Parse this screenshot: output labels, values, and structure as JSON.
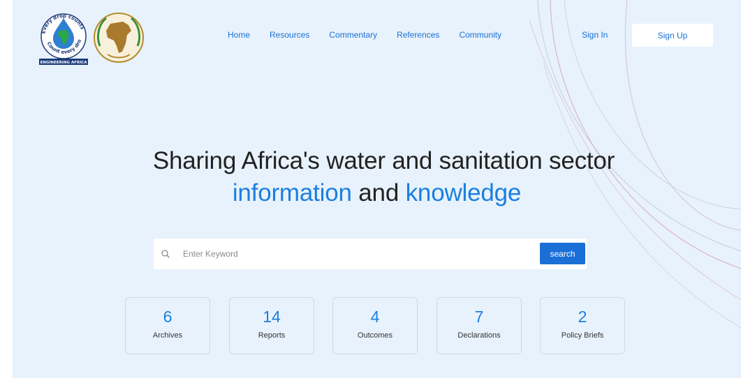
{
  "logos": {
    "water": {
      "ring_text_top": "Every drop counts",
      "ring_text_bottom": "Count every drop",
      "banner": "ENGINEERING AFRICA"
    },
    "au_emblem": "african-union-emblem"
  },
  "nav": {
    "items": [
      {
        "label": "Home"
      },
      {
        "label": "Resources"
      },
      {
        "label": "Commentary"
      },
      {
        "label": "References"
      },
      {
        "label": "Community"
      }
    ],
    "sign_in": "Sign In",
    "sign_up": "Sign Up"
  },
  "hero": {
    "line1": "Sharing Africa's water and sanitation sector",
    "line2_part1": "information",
    "line2_part2": " and ",
    "line2_part3": "knowledge"
  },
  "search": {
    "placeholder": "Enter Keyword",
    "button_label": "search",
    "icon": "search-icon"
  },
  "stats": [
    {
      "value": "6",
      "label": "Archives"
    },
    {
      "value": "14",
      "label": "Reports"
    },
    {
      "value": "4",
      "label": "Outcomes"
    },
    {
      "value": "7",
      "label": "Declarations"
    },
    {
      "value": "2",
      "label": "Policy Briefs"
    }
  ],
  "colors": {
    "accent": "#1a6fd6",
    "highlight": "#1a7fe0",
    "background": "#e8f2fc",
    "text": "#222222"
  }
}
